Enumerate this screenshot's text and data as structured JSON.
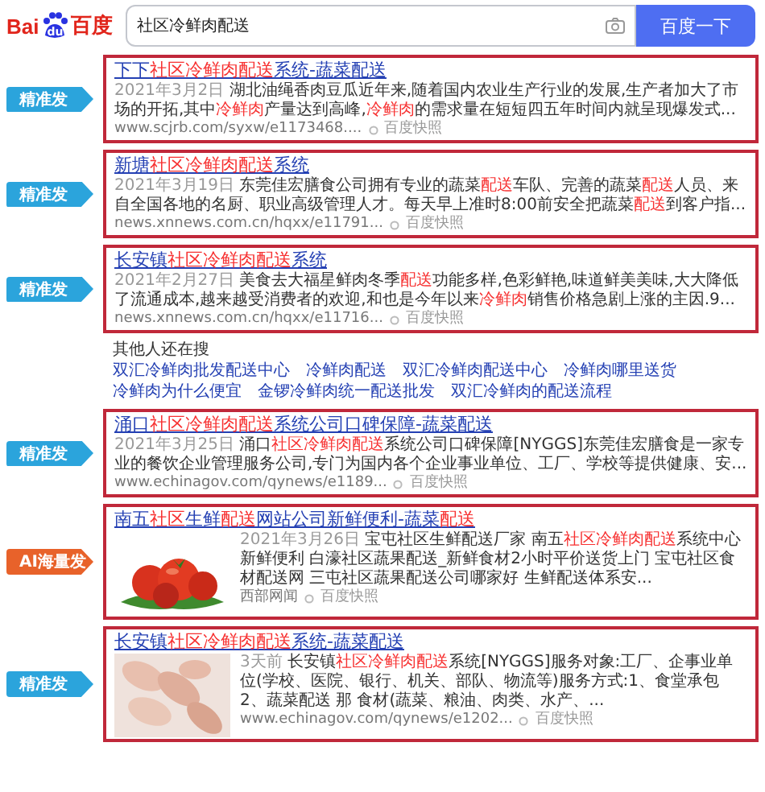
{
  "logo": {
    "parts": [
      "Bai",
      "du",
      "百度"
    ]
  },
  "search": {
    "value": "社区冷鲜肉配送",
    "button": "百度一下"
  },
  "results": [
    {
      "tag": {
        "kind": "precise",
        "label": "精准发"
      },
      "title": [
        {
          "text": "下下"
        },
        {
          "text": "社区冷鲜肉配送",
          "highlight": true
        },
        {
          "text": "系统-蔬菜配送"
        }
      ],
      "date": "2021年3月2日",
      "snippet": [
        {
          "text": "湖北油绳香肉豆瓜近年来,随着国内农业生产行业的发展,生产者加大了市场的开拓,其中"
        },
        {
          "text": "冷鲜肉",
          "highlight": true
        },
        {
          "text": "产量达到高峰,"
        },
        {
          "text": "冷鲜肉",
          "highlight": true
        },
        {
          "text": "的需求量在短短四五年时间内就呈现爆发式..."
        }
      ],
      "url": "www.scjrb.com/syxw/e1173468....",
      "snapshot": "百度快照"
    },
    {
      "tag": {
        "kind": "precise",
        "label": "精准发"
      },
      "title": [
        {
          "text": "新塘"
        },
        {
          "text": "社区冷鲜肉配送",
          "highlight": true
        },
        {
          "text": "系统"
        }
      ],
      "date": "2021年3月19日",
      "snippet": [
        {
          "text": "东莞佳宏膳食公司拥有专业的蔬菜"
        },
        {
          "text": "配送",
          "highlight": true
        },
        {
          "text": "车队、完善的蔬菜"
        },
        {
          "text": "配送",
          "highlight": true
        },
        {
          "text": "人员、来自全国各地的名厨、职业高级管理人才。每天早上准时8:00前安全把蔬菜"
        },
        {
          "text": "配送",
          "highlight": true
        },
        {
          "text": "到客户指..."
        }
      ],
      "url": "news.xnnews.com.cn/hqxx/e11791...",
      "snapshot": "百度快照"
    },
    {
      "tag": {
        "kind": "precise",
        "label": "精准发"
      },
      "title": [
        {
          "text": "长安镇"
        },
        {
          "text": "社区冷鲜肉配送",
          "highlight": true
        },
        {
          "text": "系统"
        }
      ],
      "date": "2021年2月27日",
      "snippet": [
        {
          "text": "美食去大福星鲜肉冬季"
        },
        {
          "text": "配送",
          "highlight": true
        },
        {
          "text": "功能多样,色彩鲜艳,味道鲜美美味,大大降低了流通成本,越来越受消费者的欢迎,和也是今年以来"
        },
        {
          "text": "冷鲜肉",
          "highlight": true
        },
        {
          "text": "销售价格急剧上涨的主因.9..."
        }
      ],
      "url": "news.xnnews.com.cn/hqxx/e11716...",
      "snapshot": "百度快照"
    }
  ],
  "related": {
    "heading": "其他人还在搜",
    "items": [
      "双汇冷鲜肉批发配送中心",
      "冷鲜肉配送",
      "双汇冷鲜肉配送中心",
      "冷鲜肉哪里送货",
      "冷鲜肉为什么便宜",
      "金锣冷鲜肉统一配送批发",
      "双汇冷鲜肉的配送流程"
    ]
  },
  "more_results": [
    {
      "tag": {
        "kind": "precise",
        "label": "精准发"
      },
      "title": [
        {
          "text": "涌口"
        },
        {
          "text": "社区冷鲜肉配送",
          "highlight": true
        },
        {
          "text": "系统公司口碑保障-蔬菜配送"
        }
      ],
      "date": "2021年3月25日",
      "snippet": [
        {
          "text": "涌口"
        },
        {
          "text": "社区冷鲜肉配送",
          "highlight": true
        },
        {
          "text": "系统公司口碑保障[NYGGS]东莞佳宏膳食是一家专业的餐饮企业管理服务公司,专门为国内各个企业事业单位、工厂、学校等提供健康、安..."
        }
      ],
      "url": "www.echinagov.com/qynews/e1189...",
      "snapshot": "百度快照"
    },
    {
      "tag": {
        "kind": "ai",
        "label": "AI海量发"
      },
      "image": {
        "kind": "picture"
      },
      "title": [
        {
          "text": "南五"
        },
        {
          "text": "社区",
          "highlight": true
        },
        {
          "text": "生鲜"
        },
        {
          "text": "配送",
          "highlight": true
        },
        {
          "text": "网站公司新鲜便利-蔬菜"
        },
        {
          "text": "配送",
          "highlight": true
        }
      ],
      "date": "2021年3月26日",
      "snippet": [
        {
          "text": "宝屯社区生鲜配送厂家 南五"
        },
        {
          "text": "社区冷鲜肉配送",
          "highlight": true
        },
        {
          "text": "系统中心新鲜便利 白濠社区蔬果配送_新鲜食材2小时平价送货上门 宝屯社区食材配送网 三屯社区蔬果配送公司哪家好 生鲜配送体系安..."
        }
      ],
      "url": "西部网闻",
      "snapshot": "百度快照"
    },
    {
      "tag": {
        "kind": "precise",
        "label": "精准发"
      },
      "image": {
        "kind": "picture"
      },
      "title": [
        {
          "text": "长安镇"
        },
        {
          "text": "社区冷鲜肉配送",
          "highlight": true
        },
        {
          "text": "系统-蔬菜配送"
        }
      ],
      "date": "3天前",
      "snippet": [
        {
          "text": "长安镇"
        },
        {
          "text": "社区冷鲜肉配送",
          "highlight": true
        },
        {
          "text": "系统[NYGGS]服务对象:工厂、企事业单位(学校、医院、银行、机关、部队、物流等)服务方式:1、食堂承包 2、蔬菜配送 那 食材(蔬菜、粮油、肉类、水产、..."
        }
      ],
      "url": "www.echinagov.com/qynews/e1202...",
      "snapshot": "百度快照"
    }
  ]
}
